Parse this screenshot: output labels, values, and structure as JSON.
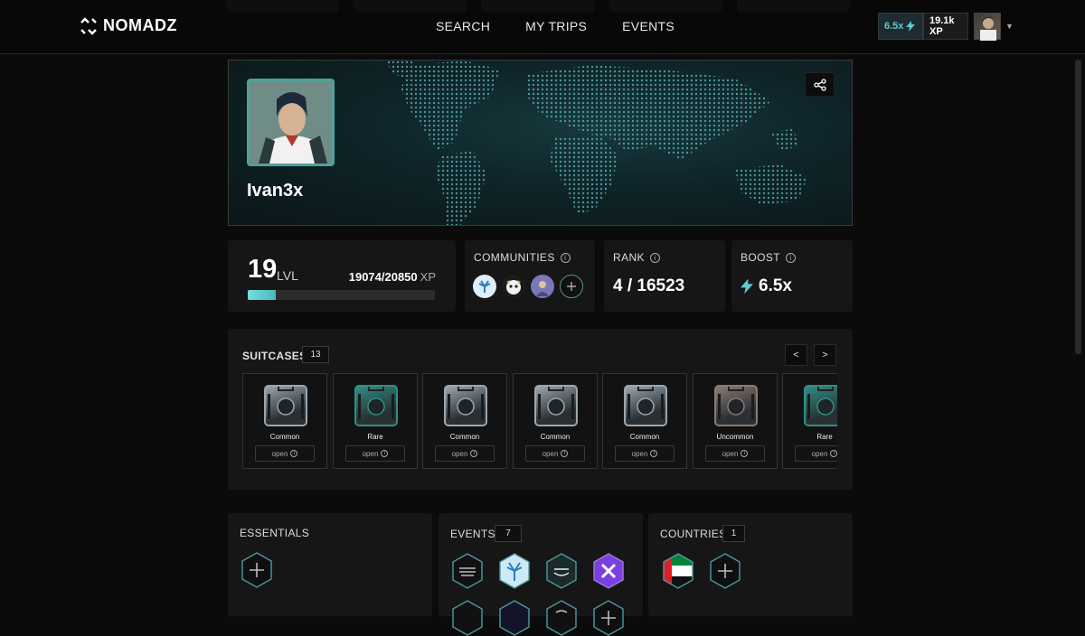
{
  "header": {
    "logo_text": "NOMADZ",
    "nav": [
      "SEARCH",
      "MY TRIPS",
      "EVENTS"
    ],
    "boost_chip": "6.5x",
    "xp_chip": "19.1k XP"
  },
  "profile": {
    "username": "Ivan3x"
  },
  "level": {
    "value": "19",
    "label": "LVL",
    "xp_current": "19074/20850",
    "xp_unit": "XP",
    "progress_fraction": 0.15
  },
  "communities": {
    "title": "COMMUNITIES"
  },
  "rank": {
    "title": "RANK",
    "value": "4 / 16523"
  },
  "boost": {
    "title": "BOOST",
    "value": "6.5x"
  },
  "suitcases": {
    "title": "SUITCASES",
    "count": "13",
    "prev": "<",
    "next": ">",
    "open_label": "open",
    "items": [
      {
        "rarity": "Common"
      },
      {
        "rarity": "Rare"
      },
      {
        "rarity": "Common"
      },
      {
        "rarity": "Common"
      },
      {
        "rarity": "Common"
      },
      {
        "rarity": "Uncommon"
      },
      {
        "rarity": "Rare"
      }
    ]
  },
  "essentials": {
    "title": "ESSENTIALS"
  },
  "events": {
    "title": "EVENTS",
    "count": "7"
  },
  "countries": {
    "title": "COUNTRIES",
    "count": "1"
  },
  "colors": {
    "accent": "#4fb8bb",
    "common_case": "#9aa7b0",
    "rare_case": "#2f8f86",
    "uncommon_case": "#8c7a70"
  }
}
